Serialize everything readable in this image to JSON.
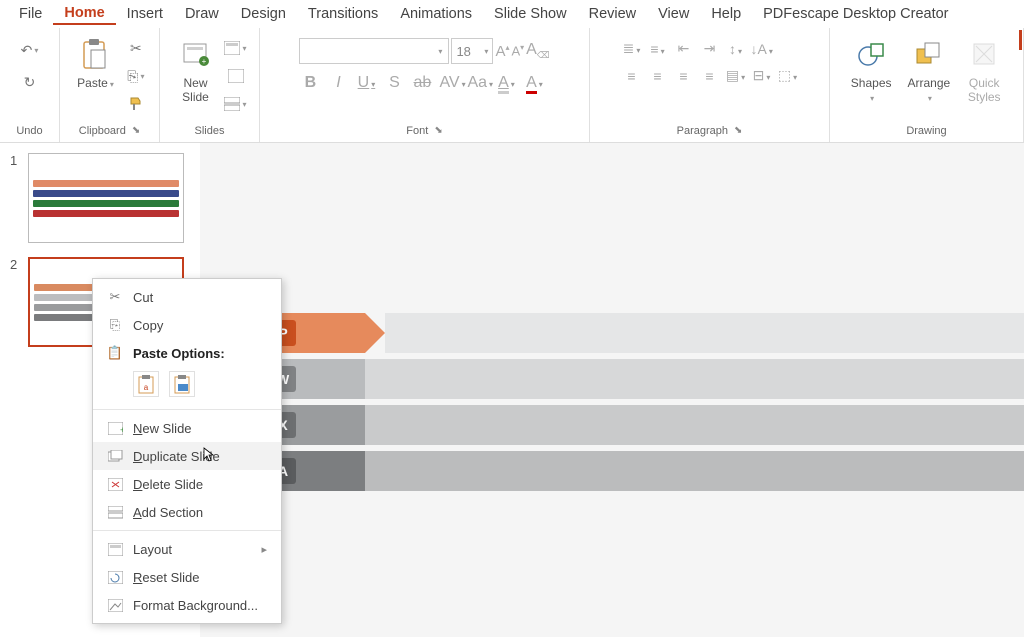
{
  "menubar": {
    "tabs": [
      "File",
      "Home",
      "Insert",
      "Draw",
      "Design",
      "Transitions",
      "Animations",
      "Slide Show",
      "Review",
      "View",
      "Help",
      "PDFescape Desktop Creator"
    ],
    "active_index": 1
  },
  "ribbon": {
    "undo": {
      "label": "Undo"
    },
    "clipboard": {
      "label": "Clipboard",
      "paste": "Paste"
    },
    "slides": {
      "label": "Slides",
      "new_slide": "New\nSlide"
    },
    "font": {
      "label": "Font",
      "name_placeholder": "",
      "size": "18",
      "buttons": {
        "bold": "B",
        "italic": "I",
        "underline": "U",
        "strike": "S",
        "strike2": "ab",
        "spacing": "AV",
        "case": "Aa",
        "clear": "A"
      },
      "grow": "A",
      "shrink": "A"
    },
    "paragraph": {
      "label": "Paragraph"
    },
    "drawing": {
      "label": "Drawing",
      "shapes": "Shapes",
      "arrange": "Arrange",
      "quick": "Quick\nStyles"
    }
  },
  "thumbs": {
    "items": [
      {
        "num": "1",
        "bars": [
          "#e08a66",
          "#3a4a8a",
          "#2a7a3a",
          "#b93232"
        ]
      },
      {
        "num": "2",
        "bars": [
          "#d98a60",
          "#bcbdbf",
          "#9a9b9d",
          "#7a7b7d"
        ]
      }
    ],
    "selected_index": 1
  },
  "context_menu": {
    "cut": "Cut",
    "copy": "Copy",
    "paste_options": "Paste Options:",
    "new_slide": "New Slide",
    "duplicate_slide": "Duplicate Slide",
    "delete_slide": "Delete Slide",
    "add_section": "Add Section",
    "layout": "Layout",
    "reset_slide": "Reset Slide",
    "format_background": "Format Background...",
    "hovered": "duplicate_slide"
  },
  "canvas": {
    "rows": [
      {
        "letter": "P",
        "bg": "#e68a5c",
        "tip": "#e68a5c",
        "icon_bg": "#d35400",
        "trail": "#e5e6e7"
      },
      {
        "letter": "W",
        "bg": "#b9bbbd",
        "tip": "#b9bbbd",
        "icon_bg": "#808284",
        "trail": "#d7d8d9"
      },
      {
        "letter": "X",
        "bg": "#9a9c9e",
        "tip": "#9a9c9e",
        "icon_bg": "#6d6f71",
        "trail": "#c9cacb"
      },
      {
        "letter": "A",
        "bg": "#7c7e80",
        "tip": "#7c7e80",
        "icon_bg": "#5a5c5e",
        "trail": "#bbbcbd"
      }
    ]
  }
}
